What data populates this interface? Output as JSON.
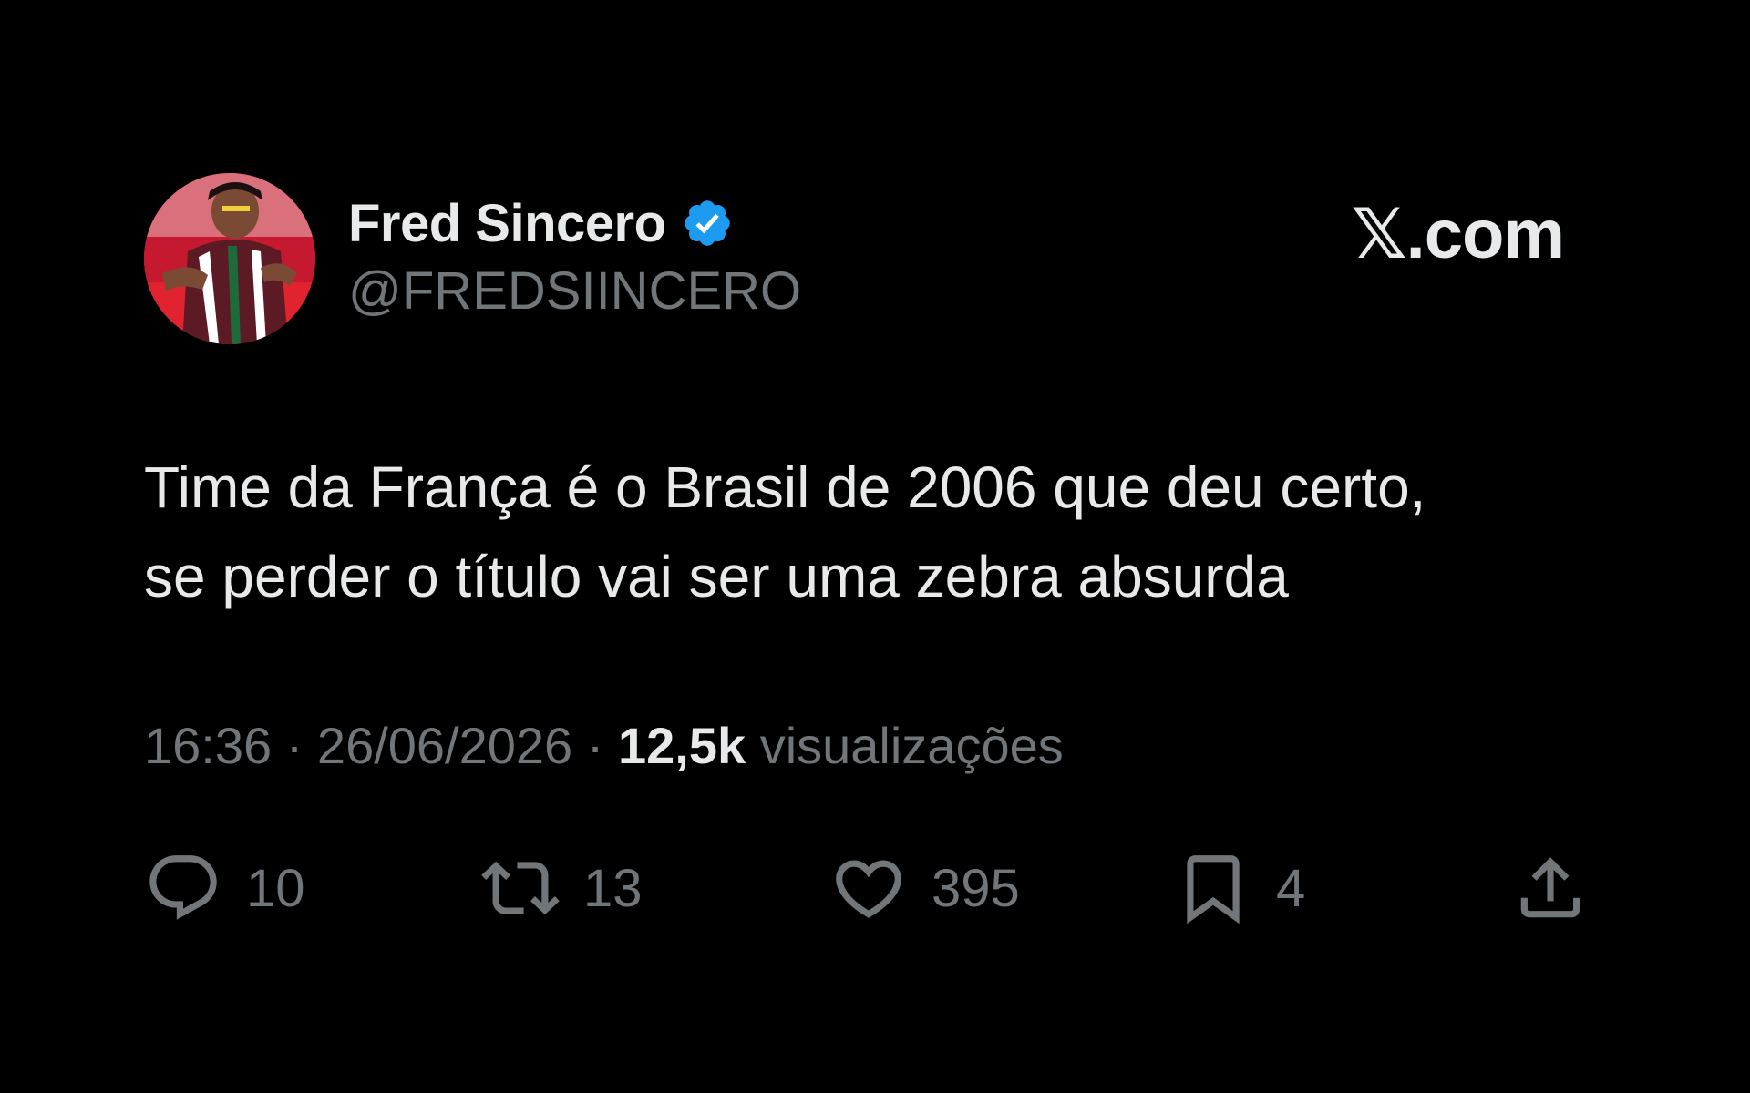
{
  "brand": {
    "label": "𝕏.com"
  },
  "author": {
    "display_name": "Fred Sincero",
    "handle": "@FREDSIINCERO",
    "verified": true,
    "verified_color": "#1d9bf0",
    "avatar_icon": "profile-photo"
  },
  "tweet": {
    "lines": [
      "Time da França é o Brasil de 2006 que deu certo,",
      "se perder o título vai ser uma zebra absurda"
    ]
  },
  "meta": {
    "time": "16:36",
    "separator": "·",
    "date": "26/06/2026",
    "views_count": "12,5k",
    "views_label": "visualizações"
  },
  "actions": {
    "reply": {
      "icon": "reply-icon",
      "count": "10"
    },
    "retweet": {
      "icon": "retweet-icon",
      "count": "13"
    },
    "like": {
      "icon": "heart-icon",
      "count": "395"
    },
    "bookmark": {
      "icon": "bookmark-icon",
      "count": "4"
    },
    "share": {
      "icon": "share-icon"
    }
  },
  "colors": {
    "background": "#000000",
    "text_primary": "#e7e9ea",
    "text_secondary": "#71767b"
  }
}
